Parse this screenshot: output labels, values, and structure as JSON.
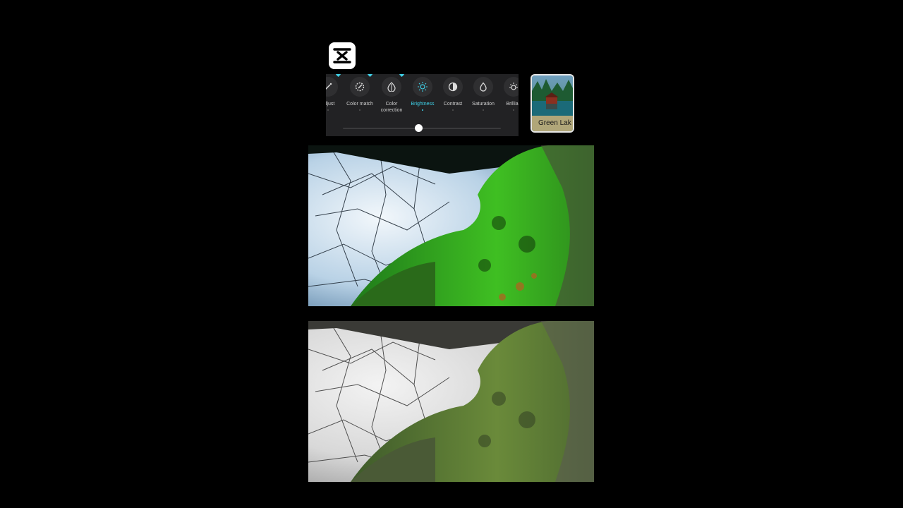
{
  "app": {
    "logo_icon": "capcut-logo-icon"
  },
  "adjust_panel": {
    "tools": [
      {
        "label": "adjust",
        "icon": "wand-icon",
        "premium": true,
        "active": false
      },
      {
        "label": "Color match",
        "icon": "color-match-icon",
        "premium": true,
        "active": false
      },
      {
        "label": "Color\ncorrection",
        "icon": "color-correction-icon",
        "premium": true,
        "active": false
      },
      {
        "label": "Brightness",
        "icon": "brightness-icon",
        "premium": false,
        "active": true
      },
      {
        "label": "Contrast",
        "icon": "contrast-icon",
        "premium": false,
        "active": false
      },
      {
        "label": "Saturation",
        "icon": "saturation-icon",
        "premium": false,
        "active": false
      },
      {
        "label": "Brillian",
        "icon": "brilliance-icon",
        "premium": false,
        "active": false
      }
    ],
    "slider": {
      "value_fraction": 0.48
    },
    "accent_color": "#3fd1e8"
  },
  "filter_thumbnail": {
    "label": "Green Lak"
  },
  "previews": [
    {
      "name": "edited-preview"
    },
    {
      "name": "original-preview"
    }
  ]
}
